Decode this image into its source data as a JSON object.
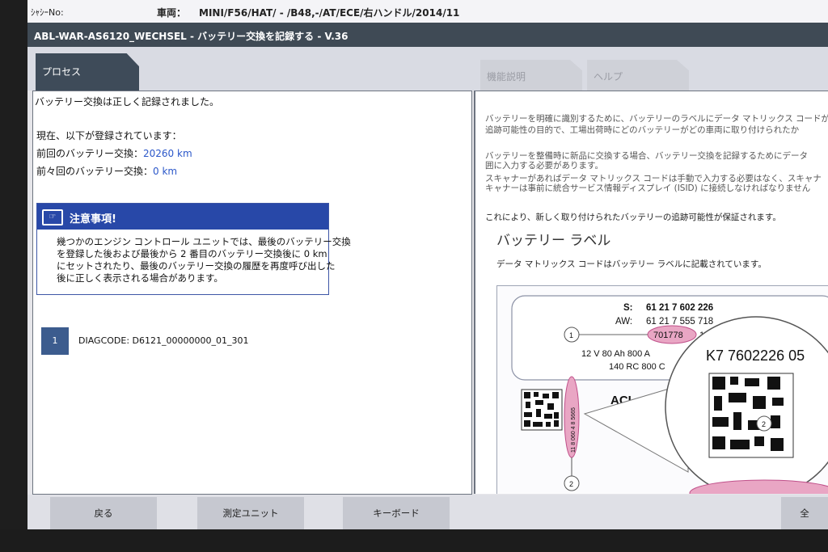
{
  "topbar": {
    "chassis_label": "ｼｬｼｰNo:",
    "vehicle_label": "車両：",
    "vehicle_value": "MINI/F56/HAT/ - /B48,-/AT/ECE/右ハンドル/2014/11"
  },
  "title": "ABL-WAR-AS6120_WECHSEL - バッテリー交換を記録する - V.36",
  "tabs": {
    "process": "プロセス",
    "function": "機能説明",
    "help": "ヘルプ"
  },
  "left": {
    "success": "バッテリー交換は正しく記録されました。",
    "registered_heading": "現在、以下が登録されています：",
    "prev_label": "前回のバッテリー交換：",
    "prev_value": "20260 km",
    "prev2_label": "前々回のバッテリー交換：",
    "prev2_value": "0 km",
    "notice_title": "注意事項!",
    "notice_lines": [
      "幾つかのエンジン コントロール ユニットでは、最後のバッテリー交換",
      "を登録した後および最後から 2 番目のバッテリー交換後に 0 km",
      "にセットされたり、最後のバッテリー交換の履歴を再度呼び出した",
      "後に正しく表示される場合があります。"
    ],
    "step_number": "1",
    "step_text": "DIAGCODE: D6121_00000000_01_301"
  },
  "right": {
    "p1": [
      "バッテリーを明確に識別するために、バッテリーのラベルにデータ マトリックス コードが",
      "追跡可能性の目的で、工場出荷時にどのバッテリーがどの車両に取り付けられたか"
    ],
    "p2": [
      "バッテリーを整備時に新品に交換する場合、バッテリー交換を記録するためにデータ",
      "囲に入力する必要があります。",
      "スキャナーがあればデータ マトリックス コードは手動で入力する必要はなく、スキャナ",
      "キャナーは事前に統合サービス情報ディスプレイ (ISID) に接続しなければなりません"
    ],
    "p3": "これにより、新しく取り付けられたバッテリーの追跡可能性が保証されます。",
    "heading": "バッテリー ラベル",
    "caption": "データ マトリックス コードはバッテリー ラベルに記載されています。",
    "figure": {
      "s_label": "S:",
      "s_value": "61 21 7 602 226",
      "aw_label": "AW:",
      "aw_value": "61 21 7 555 718",
      "highlight": "701778",
      "suffix": "10 AT",
      "spec1": "12 V  80 Ah   800 A",
      "spec2": "140 RC 800 C",
      "code": "K7 7602226 05",
      "marker1": "1",
      "marker2": "2",
      "vertical_code": "11 8 060 4 8 5665",
      "brand": "ACI"
    }
  },
  "buttons": {
    "back": "戻る",
    "measure": "測定ユニット",
    "keyboard": "キーボード",
    "all": "全"
  },
  "colors": {
    "title_bg": "#3f4a55",
    "notice_bg": "#2848a8",
    "accent_blue": "#2b57c9",
    "highlight_pink": "#e9a6c4"
  }
}
